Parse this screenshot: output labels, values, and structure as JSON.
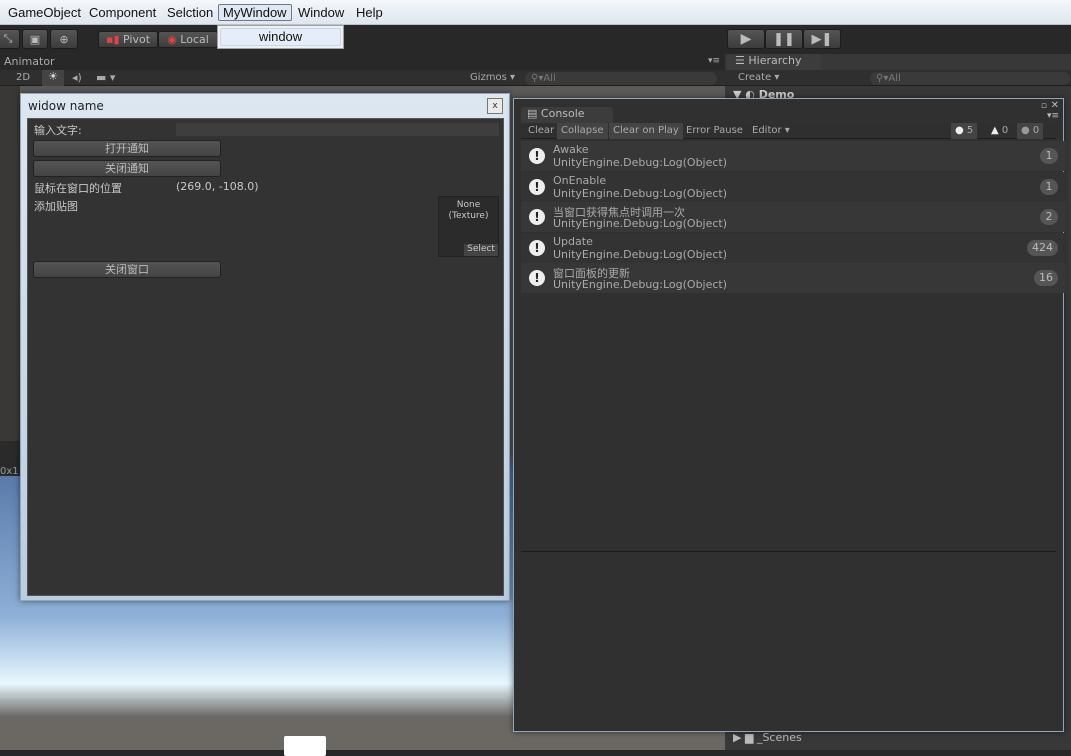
{
  "menubar": {
    "items": [
      "GameObject",
      "Component",
      "Selction",
      "MyWindow",
      "Window",
      "Help"
    ],
    "dropdown_item": "window"
  },
  "toolbar": {
    "pivot": "Pivot",
    "local": "Local"
  },
  "scene": {
    "tab": "Animator",
    "mode_2d": "2D",
    "gizmos": "Gizmos",
    "search_placeholder": "All",
    "resolution": "0x1"
  },
  "hierarchy": {
    "tab": "Hierarchy",
    "create": "Create",
    "search_placeholder": "All",
    "root": "Demo",
    "folder": "_Scenes"
  },
  "custom_window": {
    "title": "widow name",
    "close": "x",
    "input_label": "输入文字:",
    "input_value": "",
    "open_notify": "打开通知",
    "close_notify": "关闭通知",
    "mouse_pos_label": "鼠标在窗口的位置",
    "mouse_pos_value": "(269.0, -108.0)",
    "texture_label": "添加贴图",
    "texture_none": "None",
    "texture_type": "(Texture)",
    "texture_select": "Select",
    "close_window": "关闭窗口"
  },
  "console": {
    "tab": "Console",
    "toolbar": {
      "clear": "Clear",
      "collapse": "Collapse",
      "clear_on_play": "Clear on Play",
      "error_pause": "Error Pause",
      "editor": "Editor"
    },
    "counts": {
      "logs": "5",
      "warnings": "0",
      "errors": "0"
    },
    "entries": [
      {
        "message": "Awake",
        "trace": "UnityEngine.Debug:Log(Object)",
        "count": "1"
      },
      {
        "message": "OnEnable",
        "trace": "UnityEngine.Debug:Log(Object)",
        "count": "1"
      },
      {
        "message": "当窗口获得焦点时调用一次",
        "trace": "UnityEngine.Debug:Log(Object)",
        "count": "2"
      },
      {
        "message": "Update",
        "trace": "UnityEngine.Debug:Log(Object)",
        "count": "424"
      },
      {
        "message": "窗口面板的更新",
        "trace": "UnityEngine.Debug:Log(Object)",
        "count": "16"
      }
    ]
  }
}
